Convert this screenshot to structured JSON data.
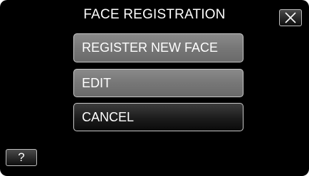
{
  "header": {
    "title": "FACE REGISTRATION",
    "close_icon": "close-icon"
  },
  "menu": {
    "items": [
      {
        "label": "REGISTER NEW FACE",
        "state": "normal"
      },
      {
        "label": "EDIT",
        "state": "normal"
      },
      {
        "label": "CANCEL",
        "state": "selected"
      }
    ]
  },
  "footer": {
    "help_label": "?",
    "help_icon": "help-icon"
  },
  "colors": {
    "background": "#000000",
    "button_normal": "#7a7a7a",
    "button_selected": "#1c1c1c",
    "border": "#c8c8c8",
    "text": "#ffffff"
  }
}
